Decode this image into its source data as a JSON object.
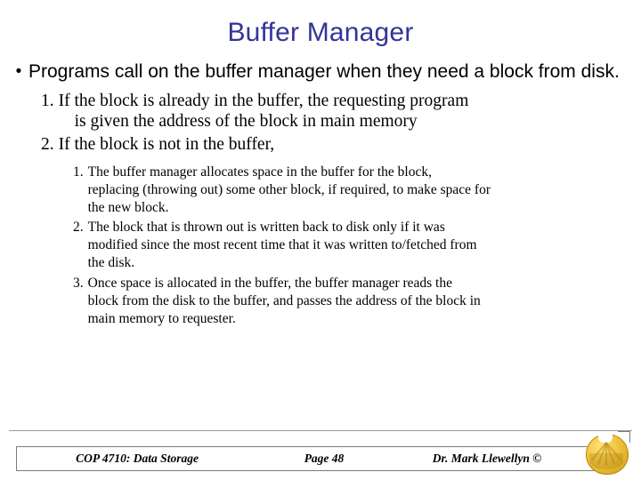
{
  "slide": {
    "title": "Buffer Manager",
    "bullet_glyph": "•",
    "level1": {
      "text": "Programs call on the buffer manager when they need a block from disk."
    },
    "level2": [
      {
        "number": "1.",
        "line1": "If the block is already in the buffer, the requesting program",
        "line2": "is given the address of the block in main memory"
      },
      {
        "number": "2.",
        "line1": "If the block is not in the buffer,",
        "line2": ""
      }
    ],
    "level3": [
      {
        "number": "1.",
        "lines": [
          "The  buffer  manager  allocates  space  in  the  buffer  for  the  block,",
          "replacing (throwing out) some other block, if required, to make space for",
          "the new block."
        ]
      },
      {
        "number": "2.",
        "lines": [
          "The  block  that  is  thrown  out  is  written  back  to  disk  only  if  it  was",
          "modified since the most recent time that it was written to/fetched from",
          "the disk."
        ]
      },
      {
        "number": "3.",
        "lines": [
          "Once  space  is  allocated  in  the  buffer,  the  buffer  manager  reads  the",
          "block from the disk to the buffer, and passes the address of the block in",
          "main memory to requester."
        ]
      }
    ],
    "footer": {
      "course": "COP 4710: Data Storage",
      "page": "Page 48",
      "author": "Dr. Mark Llewellyn ©"
    },
    "colors": {
      "title": "#333399",
      "text": "#000000",
      "footer_border": "#7b7b7b",
      "logo_gold": "#f0c33c"
    }
  }
}
